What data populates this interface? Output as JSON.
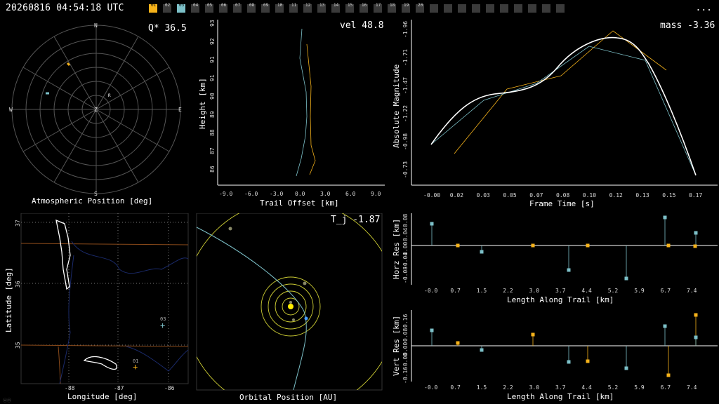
{
  "header": {
    "timestamp": "20260816 04:54:18 UTC",
    "more_label": "...",
    "stations": [
      "01",
      "02",
      "03",
      "04",
      "05",
      "06",
      "07",
      "08",
      "09",
      "10",
      "11",
      "12",
      "13",
      "14",
      "15",
      "16",
      "17",
      "18",
      "19",
      "20"
    ],
    "active_station": "01",
    "selected_station": "03"
  },
  "colors": {
    "station1": "#f5b21a",
    "station2": "#7cc0c8",
    "fit": "#ffffff",
    "grid": "#555555",
    "orbit": "#cccc33",
    "sun": "#ffee00"
  },
  "polar": {
    "title": "Atmospheric Position [deg]",
    "readout": "Q* 36.5",
    "dirs": {
      "n": "N",
      "s": "S",
      "e": "E",
      "w": "W",
      "z": "Z",
      "r": "R"
    }
  },
  "height": {
    "title": "Trail Offset [km]",
    "ylabel": "Height [km]",
    "readout": "vel 48.8",
    "xticks": [
      "-9.0",
      "-6.0",
      "-3.0",
      "0.0",
      "3.0",
      "6.0",
      "9.0"
    ],
    "yticks": [
      "86",
      "87",
      "88",
      "89",
      "90",
      "91",
      "91",
      "92",
      "93"
    ]
  },
  "mag": {
    "title": "Frame Time [s]",
    "ylabel": "Absolute Magnitude",
    "readout": "mass -3.36",
    "xticks": [
      "-0.00",
      "0.02",
      "0.03",
      "0.05",
      "0.07",
      "0.08",
      "0.10",
      "0.12",
      "0.13",
      "0.15",
      "0.17"
    ],
    "yticks": [
      "-0.73",
      "-0.98",
      "-1.22",
      "-1.47",
      "-1.71",
      "-1.96"
    ]
  },
  "map": {
    "xlabel": "Longitude [deg]",
    "ylabel": "Latitude [deg]",
    "xticks": [
      "-88",
      "-87",
      "-86"
    ],
    "yticks": [
      "35",
      "36",
      "37"
    ],
    "markers": [
      "01",
      "03"
    ]
  },
  "orbit": {
    "title": "Orbital Position [AU]",
    "readout": "T_j -1.87"
  },
  "horz": {
    "title": "Length Along Trail [km]",
    "ylabel": "Horz Res [km]",
    "xticks": [
      "-0.0",
      "0.7",
      "1.5",
      "2.2",
      "3.0",
      "3.7",
      "4.4",
      "5.2",
      "5.9",
      "6.7",
      "7.4"
    ],
    "yticks": [
      "0.08",
      "0.04",
      "0.00",
      "-0.04",
      "-0.08"
    ]
  },
  "vert": {
    "title": "Length Along Trail [km]",
    "ylabel": "Vert Res [km]",
    "xticks": [
      "-0.0",
      "0.7",
      "1.5",
      "2.2",
      "3.0",
      "3.7",
      "4.4",
      "5.2",
      "5.9",
      "6.7",
      "7.4"
    ],
    "yticks": [
      "0.16",
      "0.08",
      "0.00",
      "-0.08",
      "-0.16"
    ]
  },
  "logo": "ⓦⓜ"
}
